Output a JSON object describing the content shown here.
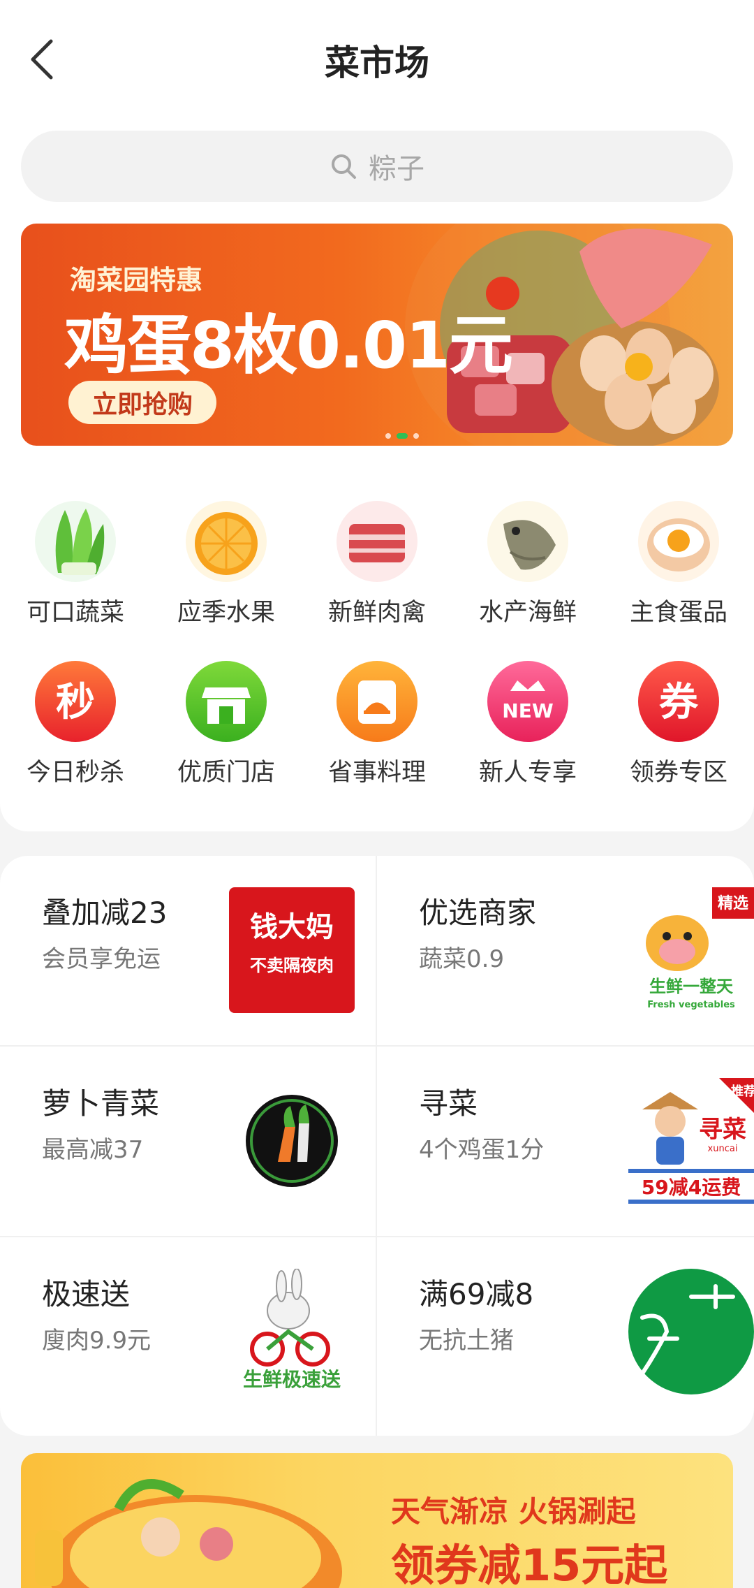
{
  "header": {
    "title": "菜市场"
  },
  "search": {
    "placeholder": "粽子"
  },
  "banner": {
    "subtitle": "淘菜园特惠",
    "headline": "鸡蛋8枚0.01元",
    "cta": "立即抢购",
    "dots_active_index": 1
  },
  "categories": [
    {
      "label": "可口蔬菜",
      "icon": "lettuce-icon"
    },
    {
      "label": "应季水果",
      "icon": "orange-icon"
    },
    {
      "label": "新鲜肉禽",
      "icon": "meat-icon"
    },
    {
      "label": "水产海鲜",
      "icon": "fish-icon"
    },
    {
      "label": "主食蛋品",
      "icon": "egg-icon"
    },
    {
      "label": "今日秒杀",
      "icon": "flash-sale-icon",
      "glyph": "秒"
    },
    {
      "label": "优质门店",
      "icon": "store-icon"
    },
    {
      "label": "省事料理",
      "icon": "cooking-icon"
    },
    {
      "label": "新人专享",
      "icon": "new-user-icon",
      "glyph": "NEW"
    },
    {
      "label": "领券专区",
      "icon": "coupon-icon",
      "glyph": "券"
    }
  ],
  "shops": [
    {
      "title": "叠加减23",
      "subtitle": "会员享免运",
      "logo_text": [
        "钱大妈",
        "不卖隔夜肉"
      ]
    },
    {
      "title": "优选商家",
      "subtitle": "蔬菜0.9",
      "logo_text": [
        "精选",
        "生鲜一整天",
        "Fresh vegetables"
      ]
    },
    {
      "title": "萝卜青菜",
      "subtitle": "最高减37",
      "logo_text": []
    },
    {
      "title": "寻菜",
      "subtitle": "4个鸡蛋1分",
      "logo_text": [
        "推荐",
        "寻菜",
        "xuncai",
        "59减4运费"
      ]
    },
    {
      "title": "极速送",
      "subtitle": "廋肉9.9元",
      "logo_text": [
        "生鲜极速送"
      ]
    },
    {
      "title": "满69减8",
      "subtitle": "无抗土猪",
      "logo_text": []
    }
  ],
  "bottom_banner": {
    "line1": "天气渐凉 火锅涮起",
    "line2": "领券减15元起"
  },
  "colors": {
    "banner_orange": "#f26a1e",
    "accent_green": "#2fbf55",
    "promo_red": "#e0381c"
  }
}
